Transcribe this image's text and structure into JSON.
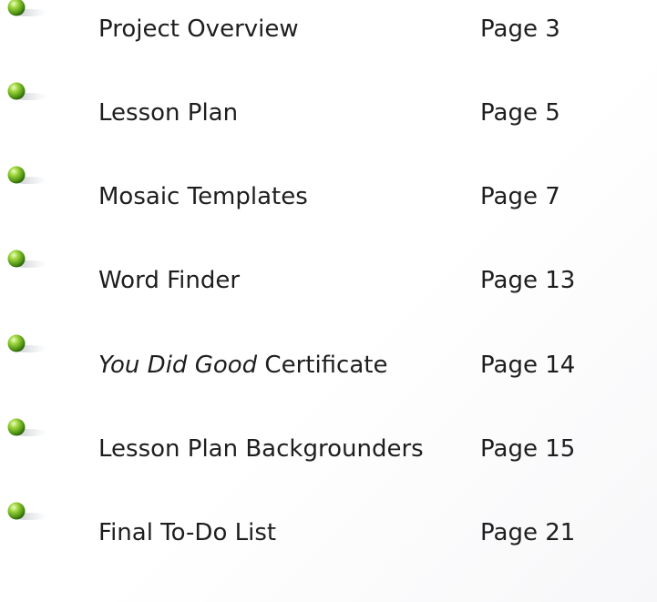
{
  "toc": {
    "entries": [
      {
        "title": "Project Overview",
        "page": "Page 3"
      },
      {
        "title": "Lesson Plan",
        "page": "Page 5"
      },
      {
        "title": "Mosaic Templates",
        "page": "Page 7"
      },
      {
        "title": "Word Finder",
        "page": "Page 13"
      },
      {
        "title_italic": "You Did Good",
        "title_rest": " Certificate",
        "page": "Page 14"
      },
      {
        "title": "Lesson Plan Backgrounders",
        "page": "Page 15"
      },
      {
        "title": "Final To-Do List",
        "page": "Page 21"
      }
    ]
  },
  "colors": {
    "bullet_green": "#7bbf1e",
    "bullet_dark": "#3d7a0e",
    "text": "#1e1e1e"
  }
}
